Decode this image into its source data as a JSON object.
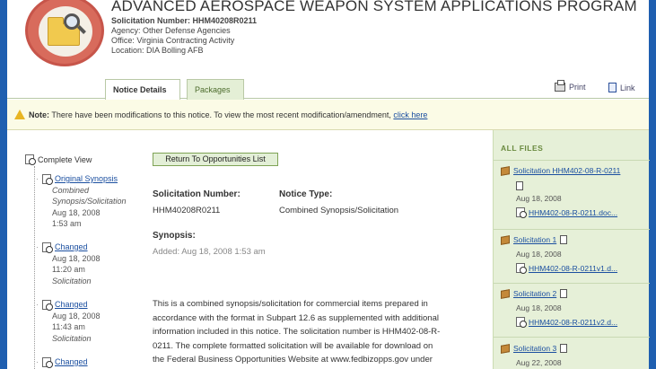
{
  "header": {
    "title": "ADVANCED AEROSPACE WEAPON SYSTEM APPLICATIONS PROGRAM",
    "solicitation_label": "Solicitation Number: HHM40208R0211",
    "agency": "Agency: Other Defense Agencies",
    "office": "Office: Virginia Contracting Activity",
    "location": "Location: DIA Bolling AFB"
  },
  "tabs": [
    {
      "label": "Notice Details",
      "active": true
    },
    {
      "label": "Packages",
      "active": false
    }
  ],
  "toolbar": {
    "print_label": "Print",
    "link_label": "Link"
  },
  "notice": {
    "prefix": "Note:",
    "message": "There have been modifications to this notice. To view the most recent modification/amendment,",
    "link_text": "click here"
  },
  "history": {
    "title": "Complete View",
    "items": [
      {
        "link": "Original Synopsis",
        "lines": [
          "Combined",
          "Synopsis/Solicitation",
          "Aug 18, 2008",
          "1:53 am"
        ]
      },
      {
        "link": "Changed",
        "lines": [
          "Aug 18, 2008",
          "11:20 am",
          "Solicitation"
        ]
      },
      {
        "link": "Changed",
        "lines": [
          "Aug 18, 2008",
          "11:43 am",
          "Solicitation"
        ]
      },
      {
        "link": "Changed",
        "lines": []
      }
    ]
  },
  "main": {
    "return_label": "Return To Opportunities List",
    "solicitation_number_label": "Solicitation Number:",
    "solicitation_number": "HHM40208R0211",
    "notice_type_label": "Notice Type:",
    "notice_type": "Combined Synopsis/Solicitation",
    "synopsis_label": "Synopsis:",
    "synopsis_added": "Added: Aug 18, 2008 1:53 am",
    "body_lines": [
      "This is a combined synopsis/solicitation for commercial items prepared in",
      "accordance with the format in Subpart 12.6 as supplemented with additional",
      "information included in this notice. The solicitation number is HHM402-08-R-",
      "0211. The complete formatted solicitation will be available for download on",
      "the Federal Business Opportunities Website at www.fedbizopps.gov under"
    ]
  },
  "files": {
    "title": "ALL FILES",
    "items": [
      {
        "name": "Solicitation HHM402-08-R-0211",
        "date": "Aug 18, 2008",
        "attachment": "HHM402-08-R-0211.doc..."
      },
      {
        "name": "Solicitation 1",
        "date": "Aug 18, 2008",
        "attachment": "HHM402-08-R-0211v1.d..."
      },
      {
        "name": "Solicitation 2",
        "date": "Aug 18, 2008",
        "attachment": "HHM402-08-R-0211v2.d..."
      },
      {
        "name": "Solicitation 3",
        "date": "Aug 22, 2008",
        "attachment": ""
      }
    ]
  }
}
